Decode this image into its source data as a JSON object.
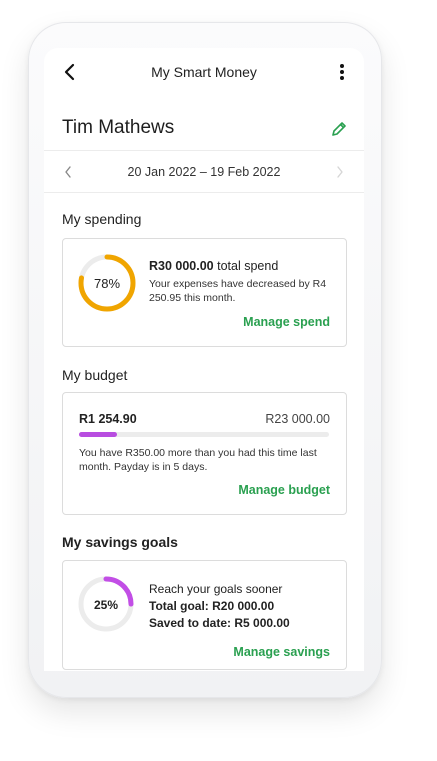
{
  "header": {
    "title": "My Smart Money"
  },
  "user": {
    "name": "Tim Mathews"
  },
  "period": {
    "range": "20 Jan 2022 – 19 Feb 2022"
  },
  "spending": {
    "section_title": "My spending",
    "percent": 78,
    "percent_label": "78%",
    "amount": "R30 000.00",
    "amount_suffix": " total spend",
    "note": "Your expenses have decreased by R4 250.95 this month.",
    "link": "Manage spend"
  },
  "budget": {
    "section_title": "My budget",
    "spent": "R1 254.90",
    "total": "R23 000.00",
    "fraction": 0.15,
    "note": "You have R350.00 more than you had this time last month. Payday is in 5 days.",
    "link": "Manage budget"
  },
  "savings": {
    "section_title": "My savings goals",
    "percent": 25,
    "percent_label": "25%",
    "headline": "Reach your goals sooner",
    "total_goal": "Total goal: R20 000.00",
    "saved": "Saved to date: R5 000.00",
    "link": "Manage savings"
  },
  "colors": {
    "accent_green": "#2aa050",
    "spend_ring": "#f0a500",
    "budget_bar": "#b84de0",
    "savings_ring": "#c24ee6",
    "ring_track": "#ececec"
  },
  "icons": [
    "back-arrow-icon",
    "kebab-menu-icon",
    "pencil-edit-icon",
    "chevron-left-icon",
    "chevron-right-icon"
  ]
}
